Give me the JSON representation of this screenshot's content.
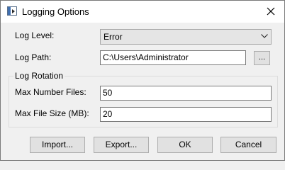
{
  "window": {
    "title": "Logging Options"
  },
  "form": {
    "log_level_label": "Log Level:",
    "log_level_value": "Error",
    "log_path_label": "Log Path:",
    "log_path_value": "C:\\Users\\Administrator",
    "browse_label": "...",
    "rotation": {
      "title": "Log Rotation",
      "max_files_label": "Max Number Files:",
      "max_files_value": "50",
      "max_size_label": "Max File Size (MB):",
      "max_size_value": "20"
    }
  },
  "buttons": {
    "import_label": "Import...",
    "export_label": "Export...",
    "ok_label": "OK",
    "cancel_label": "Cancel"
  },
  "icons": {
    "app": "app-icon",
    "close": "close-icon",
    "dropdown": "chevron-down-icon"
  }
}
